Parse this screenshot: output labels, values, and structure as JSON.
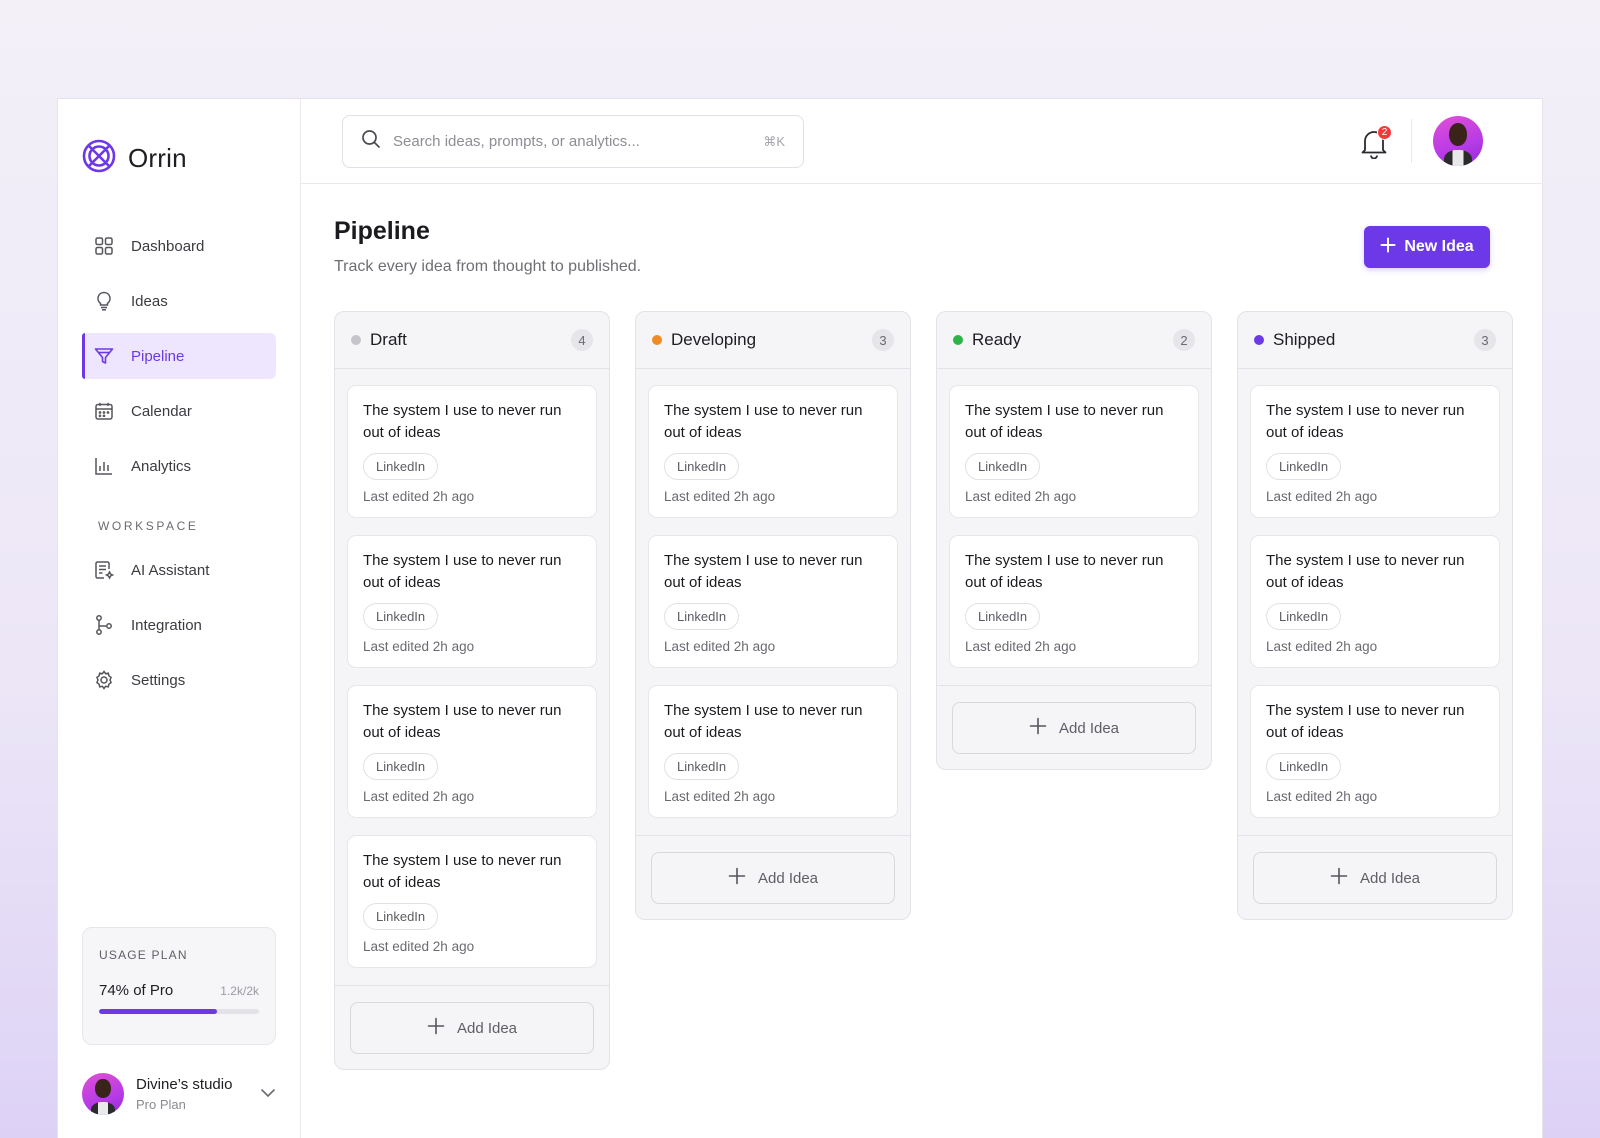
{
  "brand": {
    "name": "Orrin",
    "accent": "#6d39e8"
  },
  "sidebar": {
    "items": [
      {
        "label": "Dashboard",
        "icon": "grid-icon"
      },
      {
        "label": "Ideas",
        "icon": "lightbulb-icon"
      },
      {
        "label": "Pipeline",
        "icon": "funnel-icon",
        "active": true
      },
      {
        "label": "Calendar",
        "icon": "calendar-icon"
      },
      {
        "label": "Analytics",
        "icon": "bar-chart-icon"
      }
    ],
    "workspace_label": "WORKSPACE",
    "workspace_items": [
      {
        "label": "AI Assistant",
        "icon": "document-sparkle-icon"
      },
      {
        "label": "Integration",
        "icon": "git-branch-icon"
      },
      {
        "label": "Settings",
        "icon": "gear-icon"
      }
    ],
    "usage": {
      "label": "USAGE PLAN",
      "percent_text": "74% of Pro",
      "count": "1.2k/2k",
      "fill": 0.74
    },
    "profile": {
      "name": "Divine’s studio",
      "plan": "Pro Plan"
    }
  },
  "topbar": {
    "search_placeholder": "Search ideas, prompts, or analytics...",
    "shortcut": "⌘K",
    "notification_count": "2"
  },
  "page": {
    "title": "Pipeline",
    "subtitle": "Track every idea from thought to published.",
    "new_button": "New Idea"
  },
  "board": {
    "add_label": "Add Idea",
    "columns": [
      {
        "name": "Draft",
        "count": "4",
        "color": "#c4c4ca",
        "cards": [
          {
            "title": "The system I use to never run out of ideas",
            "tag": "LinkedIn",
            "meta": "Last edited 2h ago"
          },
          {
            "title": "The system I use to never run out of ideas",
            "tag": "LinkedIn",
            "meta": "Last edited 2h ago"
          },
          {
            "title": "The system I use to never run out of ideas",
            "tag": "LinkedIn",
            "meta": "Last edited 2h ago"
          },
          {
            "title": "The system I use to never run out of ideas",
            "tag": "LinkedIn",
            "meta": "Last edited 2h ago"
          }
        ]
      },
      {
        "name": "Developing",
        "count": "3",
        "color": "#f08a24",
        "cards": [
          {
            "title": "The system I use to never run out of ideas",
            "tag": "LinkedIn",
            "meta": "Last edited 2h ago"
          },
          {
            "title": "The system I use to never run out of ideas",
            "tag": "LinkedIn",
            "meta": "Last edited 2h ago"
          },
          {
            "title": "The system I use to never run out of ideas",
            "tag": "LinkedIn",
            "meta": "Last edited 2h ago"
          }
        ]
      },
      {
        "name": "Ready",
        "count": "2",
        "color": "#2cb34a",
        "cards": [
          {
            "title": "The system I use to never run out of ideas",
            "tag": "LinkedIn",
            "meta": "Last edited 2h ago"
          },
          {
            "title": "The system I use to never run out of ideas",
            "tag": "LinkedIn",
            "meta": "Last edited 2h ago"
          }
        ]
      },
      {
        "name": "Shipped",
        "count": "3",
        "color": "#6d39e8",
        "cards": [
          {
            "title": "The system I use to never run out of ideas",
            "tag": "LinkedIn",
            "meta": "Last edited 2h ago"
          },
          {
            "title": "The system I use to never run out of ideas",
            "tag": "LinkedIn",
            "meta": "Last edited 2h ago"
          },
          {
            "title": "The system I use to never run out of ideas",
            "tag": "LinkedIn",
            "meta": "Last edited 2h ago"
          }
        ]
      }
    ]
  }
}
